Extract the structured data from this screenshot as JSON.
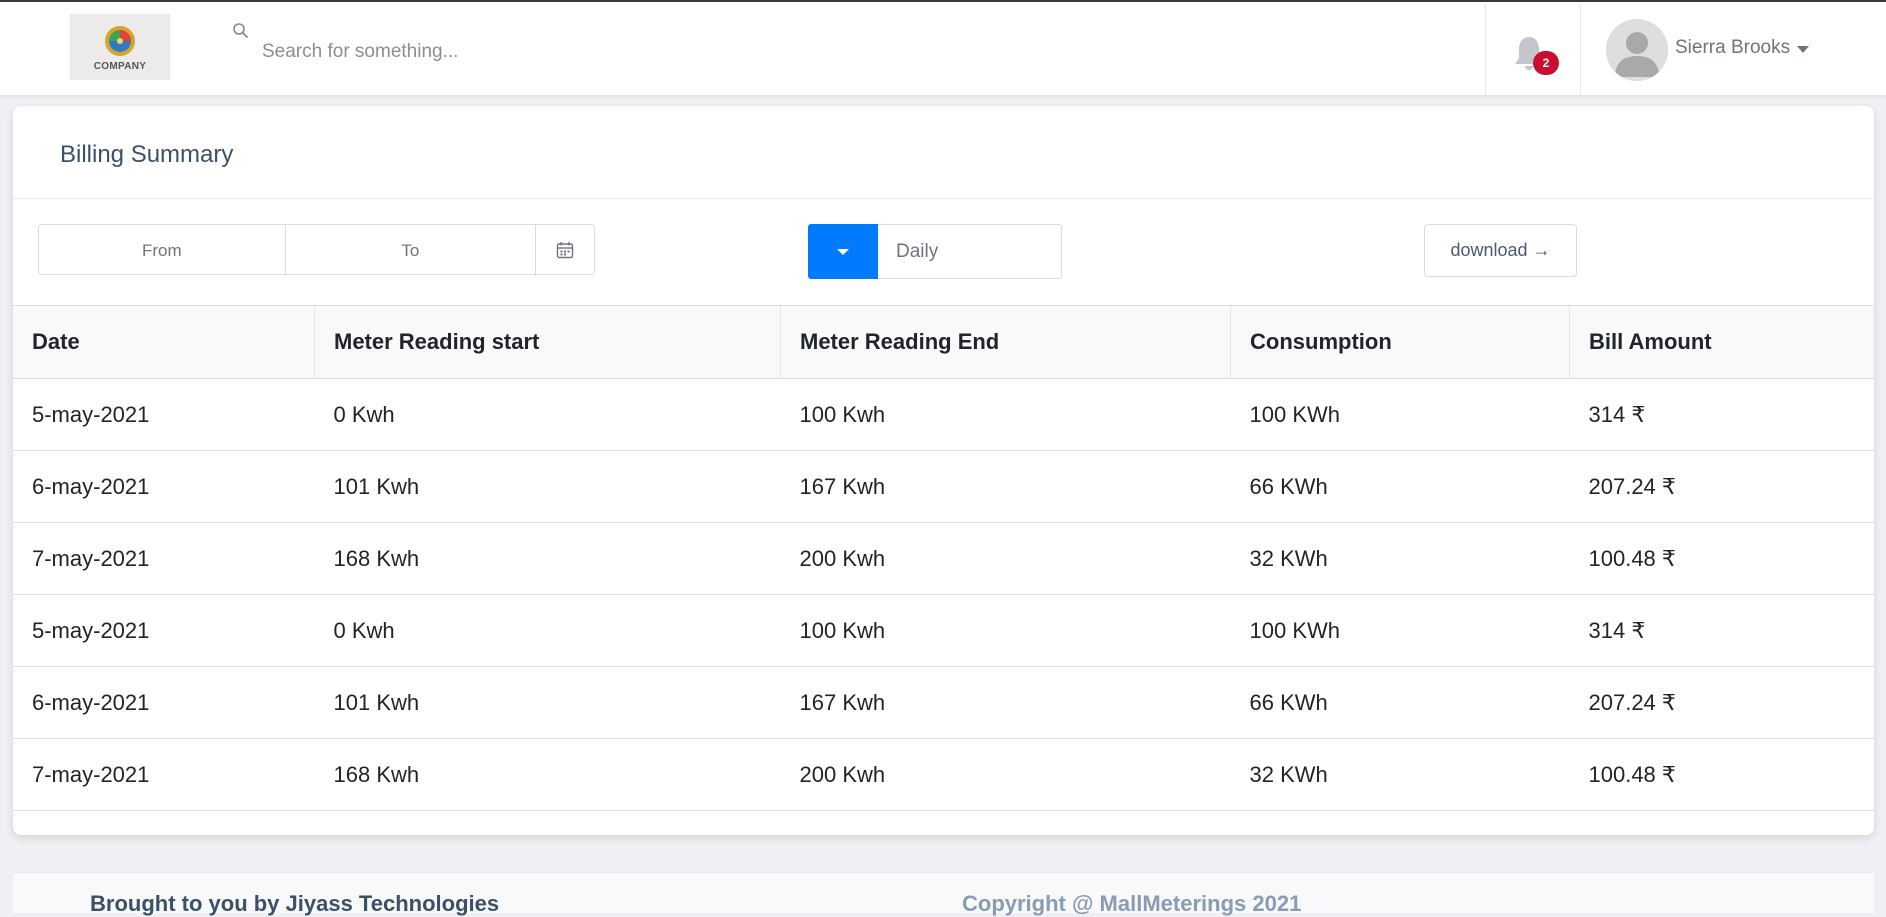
{
  "header": {
    "logo_text": "COMPANY",
    "search_placeholder": "Search for something...",
    "notification_count": "2",
    "user_name": "Sierra Brooks"
  },
  "billing": {
    "title": "Billing Summary",
    "from_placeholder": "From",
    "to_placeholder": "To",
    "period": "Daily",
    "download_label": "download →",
    "columns": [
      "Date",
      "Meter Reading start",
      "Meter Reading End",
      "Consumption",
      "Bill Amount"
    ],
    "rows": [
      [
        "5-may-2021",
        "0 Kwh",
        "100 Kwh",
        "100 KWh",
        "314 ₹"
      ],
      [
        "6-may-2021",
        "101 Kwh",
        "167 Kwh",
        "66 KWh",
        "207.24 ₹"
      ],
      [
        "7-may-2021",
        "168 Kwh",
        "200 Kwh",
        "32 KWh",
        "100.48 ₹"
      ],
      [
        "5-may-2021",
        "0 Kwh",
        "100 Kwh",
        "100 KWh",
        "314 ₹"
      ],
      [
        "6-may-2021",
        "101 Kwh",
        "167 Kwh",
        "66 KWh",
        "207.24 ₹"
      ],
      [
        "7-may-2021",
        "168 Kwh",
        "200 Kwh",
        "32 KWh",
        "100.48 ₹"
      ]
    ]
  },
  "footer": {
    "left_text": "Brought to you by Jiyass Technologies",
    "right_text": "Copyright @ MallMeterings 2021"
  },
  "colors": {
    "accent": "#007bff",
    "badge": "#c8102e",
    "title": "#3a5168"
  }
}
